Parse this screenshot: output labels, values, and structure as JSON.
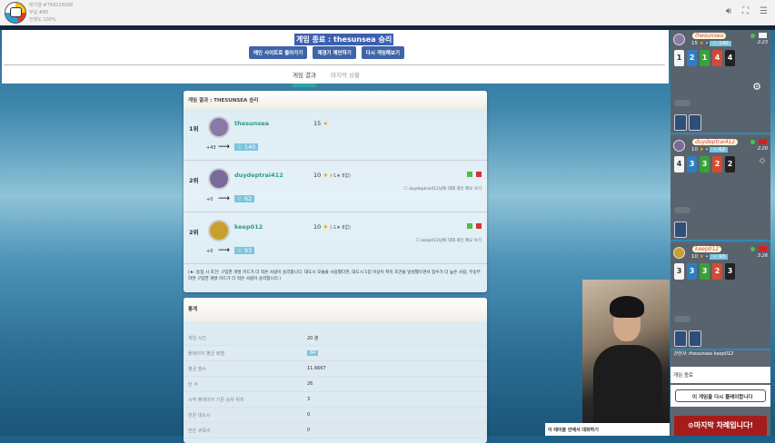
{
  "topbar": {
    "line1": "애기엘 #768229268",
    "line2": "무실 #80",
    "line3": "진행도 100%"
  },
  "header": {
    "title": "게임 종료 : thesunsea 승리",
    "buttons": [
      "메인 사이트로 돌아가기",
      "재경기 제안하기",
      "다시 게임해보기"
    ],
    "tabs": [
      "게임 결과",
      "마지막 상황"
    ]
  },
  "result": {
    "title": "게임 결과 : THESUNSEA 승리",
    "players": [
      {
        "rank": "1위",
        "name": "thesunsea",
        "score": "15",
        "extra": "",
        "delta": "+43",
        "rating": "140",
        "memo": ""
      },
      {
        "rank": "2위",
        "name": "duydeptrai412",
        "score": "10",
        "extra": "(-1★ 8없)",
        "delta": "+0",
        "rating": "62",
        "memo": "duydeptrai412님에 대해 개인 메모 쓰기"
      },
      {
        "rank": "2위",
        "name": "keep012",
        "score": "10",
        "extra": "(-1★ 8없)",
        "delta": "+0",
        "rating": "93",
        "memo": "keep012님에 대해 개인 메모 보기"
      }
    ],
    "note": "(★: 동점 시 조건: 구입한 개발 카드가 더 적은 사람이 승리합니다. 대도시 모듈을 사용했다면, 대도시 1장 이상이 획득 조건을 달성했으면서 점수가 더 높은 사람, 무승부라면 구입한 개발 카드가 더 적은 사람이 승리합니다.)"
  },
  "stats": {
    "title": "통계",
    "rows": [
      {
        "k": "게임 시간",
        "v": "20 분"
      },
      {
        "k": "플레이어 평균 레벨",
        "v": "84"
      },
      {
        "k": "평균 점수",
        "v": "11.6667"
      },
      {
        "k": "턴 수",
        "v": "26"
      },
      {
        "k": "시작 플레이어 기준 승자 위치",
        "v": "3"
      },
      {
        "k": "얻은 대도시",
        "v": "0"
      },
      {
        "k": "얻은 귀족수",
        "v": "0"
      }
    ]
  },
  "side": {
    "players": [
      {
        "name": "thesunsea",
        "stars": "15",
        "rating": "140",
        "time": "2:23",
        "cards": [
          "1",
          "2",
          "1",
          "4",
          "4"
        ]
      },
      {
        "name": "duydeptrai412",
        "stars": "10",
        "rating": "62",
        "time": "2:20",
        "cards": [
          "4",
          "3",
          "3",
          "2",
          "2"
        ]
      },
      {
        "name": "keep012",
        "stars": "10",
        "rating": "93",
        "time": "3:26",
        "cards": [
          "3",
          "3",
          "3",
          "2",
          "3"
        ]
      }
    ],
    "spectators_label": "관전자:",
    "spectators": "thesunsea  keep012",
    "end_label": "게임 종료",
    "replay": "이 게임을 다시 플레이합니다",
    "last_turn": "⊙마지막 차례입니다!",
    "card_colors": [
      "#f4f4f4",
      "#2f7fc0",
      "#3aa03a",
      "#d84a30",
      "#222222"
    ]
  },
  "chat": {
    "label": "이 테이블 안에서 대화하기"
  }
}
